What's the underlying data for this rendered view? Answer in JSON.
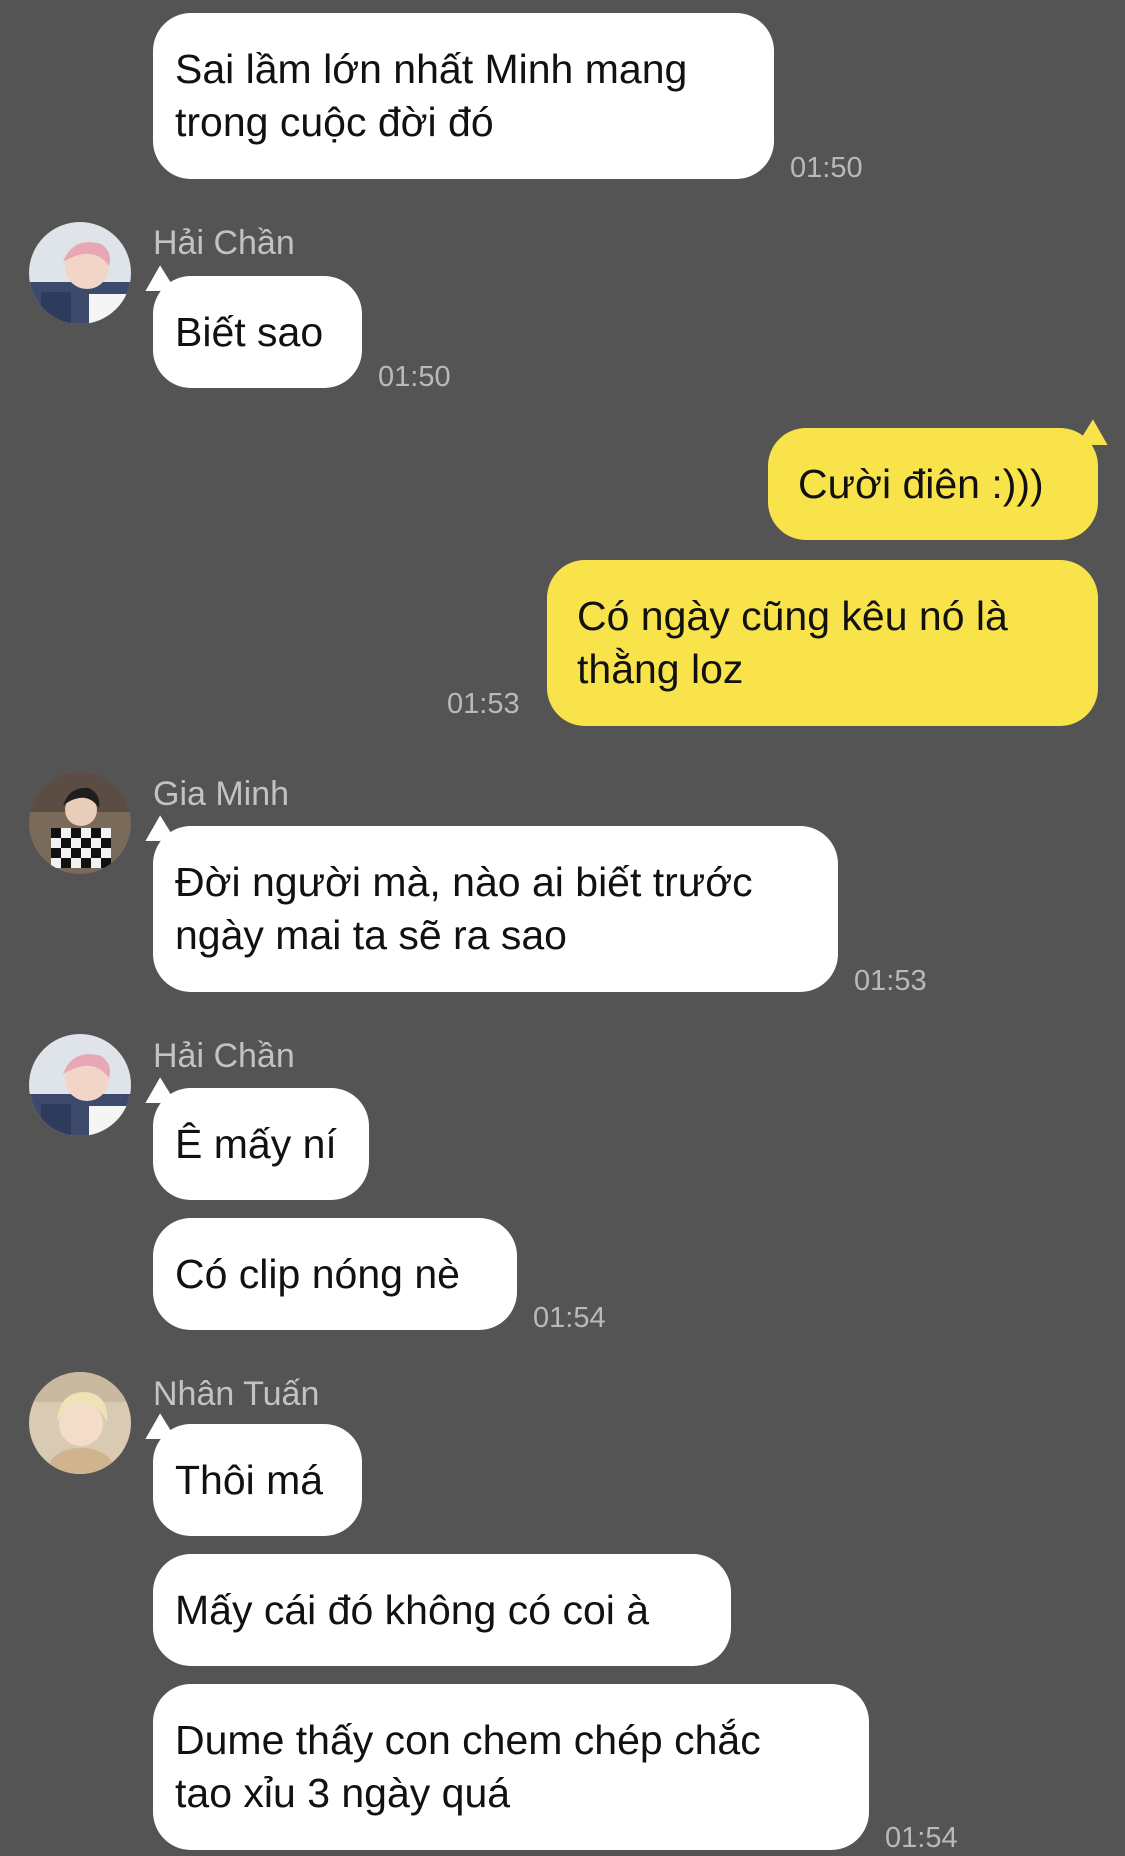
{
  "messages": [
    {
      "lines": [
        "Sai lầm lớn nhất Minh mang",
        "trong cuộc đời đó"
      ],
      "time": "01:50"
    },
    {
      "sender": "Hải Chần",
      "avatar": "pink-hair-person-avatar",
      "lines": [
        "Biết sao"
      ],
      "time": "01:50"
    },
    {
      "lines": [
        "Cười điên :)))"
      ]
    },
    {
      "lines": [
        "Có ngày cũng kêu nó là",
        "thằng loz"
      ],
      "time": "01:53"
    },
    {
      "sender": "Gia Minh",
      "avatar": "checkered-jacket-person-avatar",
      "lines": [
        "Đời người mà, nào ai biết trước",
        "ngày mai ta sẽ ra sao"
      ],
      "time": "01:53"
    },
    {
      "sender": "Hải Chần",
      "avatar": "pink-hair-person-avatar",
      "lines": [
        "Ê mấy ní"
      ]
    },
    {
      "lines": [
        "Có clip nóng nè"
      ],
      "time": "01:54"
    },
    {
      "sender": "Nhân Tuấn",
      "avatar": "blonde-hair-person-avatar",
      "lines": [
        "Thôi má"
      ]
    },
    {
      "lines": [
        "Mấy cái đó không có coi à"
      ]
    },
    {
      "lines": [
        "Dume thấy con chem chép chắc",
        "tao xỉu 3 ngày quá"
      ],
      "time": "01:54"
    }
  ],
  "colors": {
    "background": "#545454",
    "incoming_bubble": "#ffffff",
    "outgoing_bubble": "#f9e34b",
    "timestamp": "#b9b9b9",
    "sender_name": "#c2c2c2"
  }
}
